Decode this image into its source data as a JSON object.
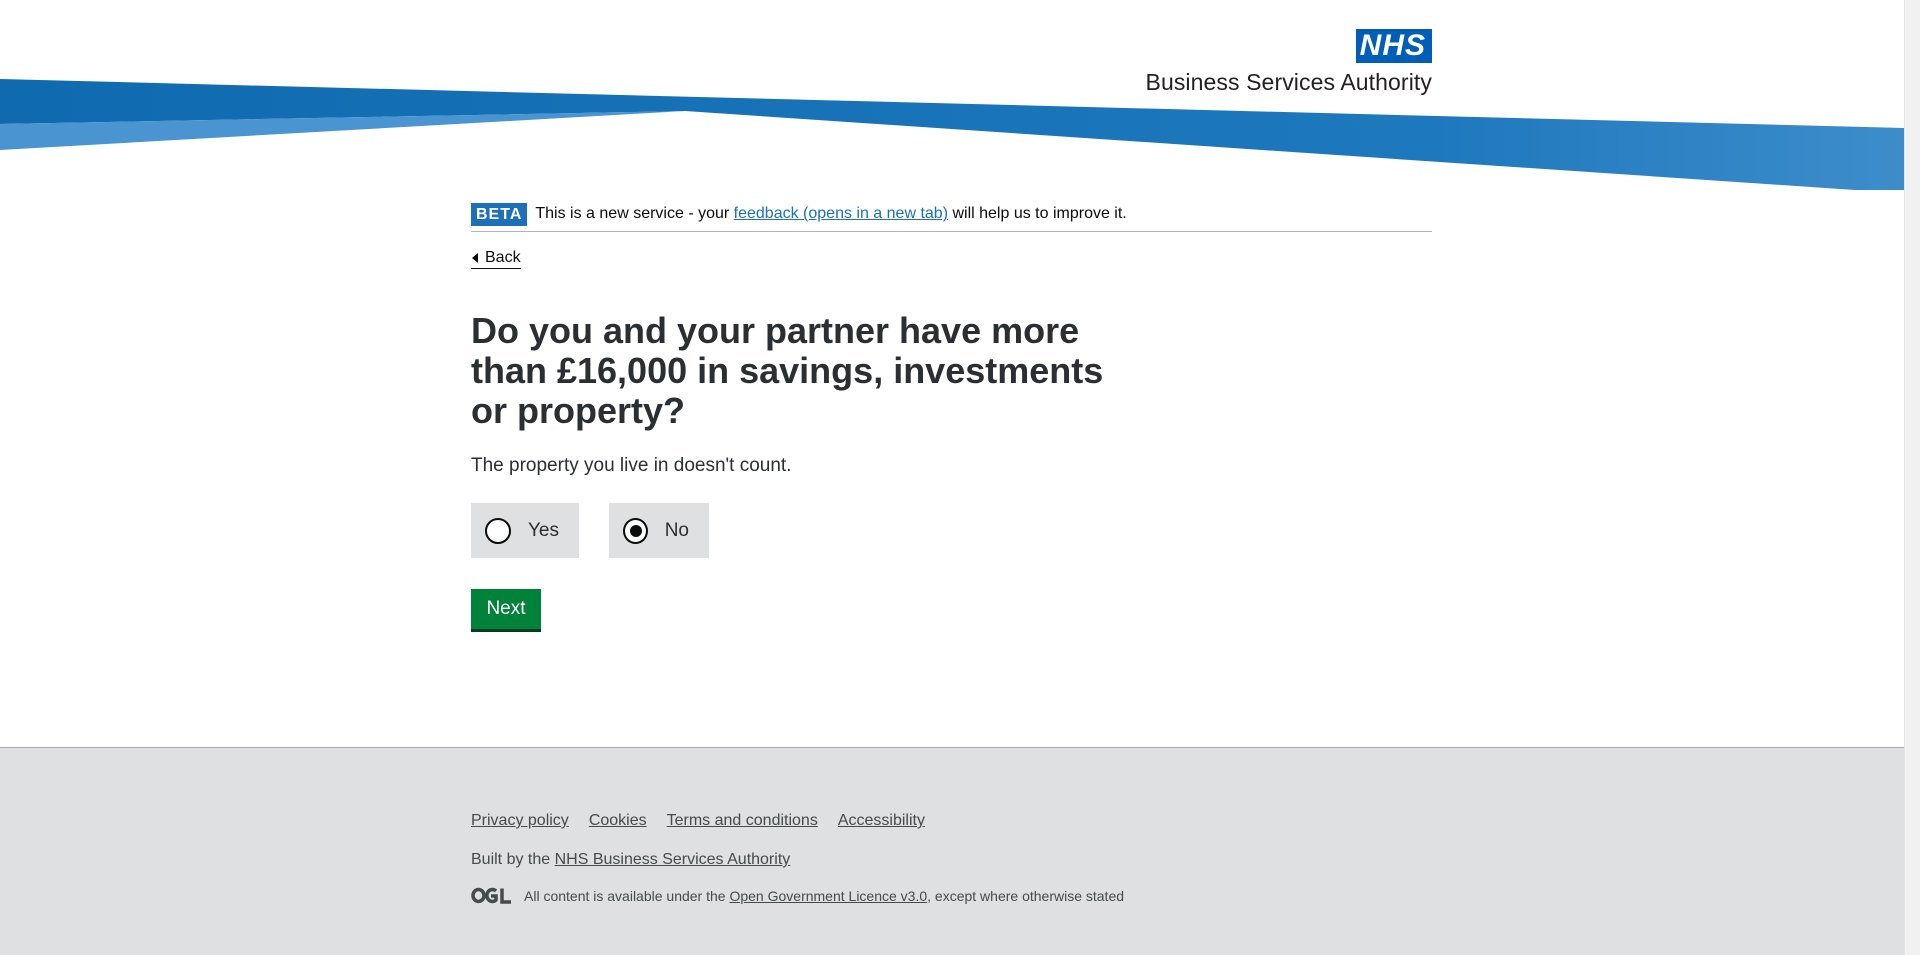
{
  "header": {
    "logo_mark": "NHS",
    "logo_text": "Business Services Authority"
  },
  "beta": {
    "tag": "BETA",
    "text_before": "This is a new service - your ",
    "link": "feedback (opens in a new tab)",
    "text_after": " will help us to improve it."
  },
  "back_link": "Back",
  "question": {
    "title": "Do you and your partner have more than £16,000 in savings, investments or property?",
    "hint": "The property you live in doesn't count.",
    "options": [
      {
        "label": "Yes",
        "selected": false
      },
      {
        "label": "No",
        "selected": true
      }
    ]
  },
  "next_button": "Next",
  "footer": {
    "links": [
      "Privacy policy",
      "Cookies",
      "Terms and conditions",
      "Accessibility"
    ],
    "built_by_prefix": "Built by the ",
    "built_by_link": "NHS Business Services Authority",
    "ogl_logo": "OGL",
    "licence_prefix": "All content is available under the ",
    "licence_link": "Open Government Licence v3.0",
    "licence_suffix": ", except where otherwise stated"
  },
  "colors": {
    "nhs_blue": "#005eb8",
    "link_blue": "#1d70b8",
    "next_green": "#00823b",
    "footer_grey": "#dee0e2",
    "radio_bg": "#dee0e2"
  }
}
